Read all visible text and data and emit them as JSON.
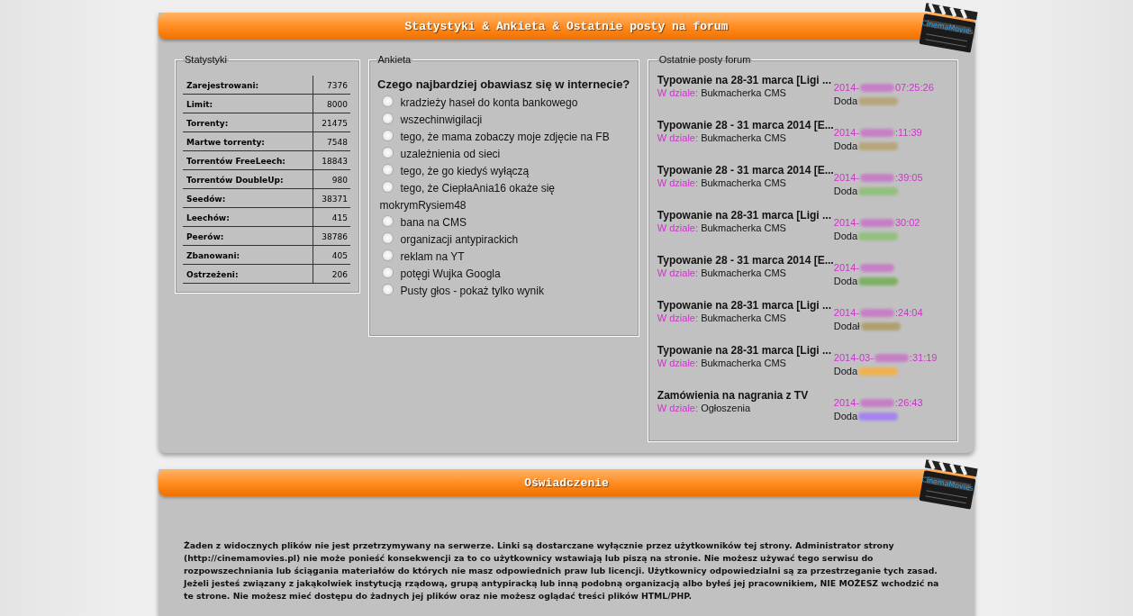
{
  "panels": [
    {
      "title": "Statystyki & Ankieta & Ostatnie posty na forum",
      "logo": "CinemaMovies"
    },
    {
      "title": "Oświadczenie",
      "logo": "CinemaMovies"
    }
  ],
  "stats": {
    "legend": "Statystyki",
    "rows": [
      {
        "label": "Zarejestrowani:",
        "value": "7376"
      },
      {
        "label": "Limit:",
        "value": "8000"
      },
      {
        "label": "Torrenty:",
        "value": "21475"
      },
      {
        "label": "Martwe torrenty:",
        "value": "7548"
      },
      {
        "label": "Torrentów FreeLeech:",
        "value": "18843"
      },
      {
        "label": "Torrentów DoubleUp:",
        "value": "980"
      },
      {
        "label": "Seedów:",
        "value": "38371"
      },
      {
        "label": "Leechów:",
        "value": "415"
      },
      {
        "label": "Peerów:",
        "value": "38786"
      },
      {
        "label": "Zbanowani:",
        "value": "405"
      },
      {
        "label": "Ostrzeżeni:",
        "value": "206"
      }
    ]
  },
  "poll": {
    "legend": "Ankieta",
    "question": "Czego najbardziej obawiasz się w internecie?",
    "options": [
      {
        "label": "kradzieży haseł do konta bankowego",
        "selected": false
      },
      {
        "label": "wszechinwigilacji",
        "selected": false
      },
      {
        "label": "tego, że mama zobaczy moje zdjęcie na FB",
        "selected": false
      },
      {
        "label": "uzależnienia od sieci",
        "selected": false
      },
      {
        "label": "tego, że go kiedyś wyłączą",
        "selected": false
      },
      {
        "label": "tego, że CiepłaAnia16 okaże się mokrymRysiem48",
        "selected": false
      },
      {
        "label": "bana na CMS",
        "selected": false
      },
      {
        "label": "organizacji antypirackich",
        "selected": false
      },
      {
        "label": "reklam na YT",
        "selected": false
      },
      {
        "label": "potęgi Wujka Googla",
        "selected": false
      },
      {
        "label": "Pusty głos - pokaż tylko wynik",
        "selected": false
      }
    ]
  },
  "posts": {
    "legend": "Ostatnie posty forum",
    "items": [
      {
        "title": "Typowanie na 28-31 marca [Ligi ...",
        "section_label": "W dziale:",
        "section": "Bukmacherka CMS",
        "date_start": "2014-",
        "date_end": "07:25:26",
        "author_label": "Doda",
        "color": "#b8a67a"
      },
      {
        "title": "Typowanie 28 - 31 marca 2014 [E...",
        "section_label": "W dziale:",
        "section": "Bukmacherka CMS",
        "date_start": "2014-",
        "date_end": ":11:39",
        "author_label": "Doda",
        "color": "#b8a67a"
      },
      {
        "title": "Typowanie 28 - 31 marca 2014 [E...",
        "section_label": "W dziale:",
        "section": "Bukmacherka CMS",
        "date_start": "2014-",
        "date_end": ":39:05",
        "author_label": "Doda",
        "color": "#92c07e"
      },
      {
        "title": "Typowanie na 28-31 marca [Ligi ...",
        "section_label": "W dziale:",
        "section": "Bukmacherka CMS",
        "date_start": "2014-",
        "date_end": "30:02",
        "author_label": "Doda",
        "color": "#92c07e"
      },
      {
        "title": "Typowanie 28 - 31 marca 2014 [E...",
        "section_label": "W dziale:",
        "section": "Bukmacherka CMS",
        "date_start": "2014-",
        "author_label": "Doda",
        "color": "#7fb062"
      },
      {
        "title": "Typowanie na 28-31 marca [Ligi ...",
        "section_label": "W dziale:",
        "section": "Bukmacherka CMS",
        "date_start": "2014-",
        "date_end": ":24:04",
        "author_label": "Dodał",
        "color": "#b0a070"
      },
      {
        "title": "Typowanie na 28-31 marca [Ligi ...",
        "section_label": "W dziale:",
        "section": "Bukmacherka CMS",
        "date_start": "2014-03-",
        "date_end": ":31:19",
        "author_label": "Doda",
        "color": "#f0b24e"
      },
      {
        "title": "Zamówienia na nagrania z TV",
        "section_label": "W dziale:",
        "section": "Ogłoszenia",
        "date_start": "2014-",
        "date_end": ":26:43",
        "author_label": "Doda",
        "color": "#a584f0"
      }
    ]
  },
  "disclaimer": "Żaden z widocznych plików nie jest przetrzymywany na serwerze. Linki są dostarczane wyłącznie przez użytkowników tej strony. Administrator strony (http://cinemamovies.pl) nie może ponieść konsekwencji za to co użytkownicy wstawiają lub piszą na stronie. Nie możesz używać tego serwisu do rozpowszechniania lub ściągania materiałów do których nie masz odpowiednich praw lub licencji. Użytkownicy odpowiedzialni są za przestrzeganie tych zasad. Jeżeli jesteś związany z jakąkolwiek instytucją rządową, grupą antypiracką lub inną podobną organizacją albo byłeś jej pracownikiem, NIE MOŻESZ wchodzić na te strone. Nie możesz mieć dostępu do żadnych jej plików oraz nie możesz oglądać treści plików HTML/PHP."
}
